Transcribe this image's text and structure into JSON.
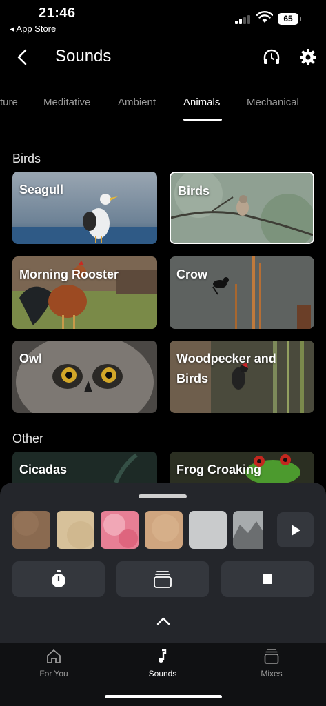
{
  "status_bar": {
    "time": "21:46",
    "back_app": "◂ App Store",
    "battery": "65"
  },
  "header": {
    "title": "Sounds",
    "back_icon": "chevron-left-icon",
    "headphones_icon": "headphones-icon",
    "settings_icon": "gear-icon"
  },
  "tabs": [
    {
      "label": "ture",
      "active": false
    },
    {
      "label": "Meditative",
      "active": false
    },
    {
      "label": "Ambient",
      "active": false
    },
    {
      "label": "Animals",
      "active": true
    },
    {
      "label": "Mechanical",
      "active": false
    }
  ],
  "sections": {
    "birds": {
      "label": "Birds",
      "cards": [
        {
          "label": "Seagull",
          "selected": false
        },
        {
          "label": "Birds",
          "selected": true
        },
        {
          "label": "Morning Rooster",
          "selected": false
        },
        {
          "label": "Crow",
          "selected": false
        },
        {
          "label": "Owl",
          "selected": false
        },
        {
          "label": "Woodpecker and Birds",
          "selected": false
        }
      ]
    },
    "other": {
      "label": "Other",
      "cards": [
        {
          "label": "Cicadas"
        },
        {
          "label": "Frog Croaking"
        }
      ]
    }
  },
  "player": {
    "swatches": [
      "#8a6a50",
      "#d7c19a",
      "#e77f95",
      "#cfa57f",
      "#c9cbcc",
      "#6b6e70"
    ],
    "play_icon": "play-icon",
    "timer_icon": "stopwatch-icon",
    "mixes_icon": "stack-icon",
    "stop_icon": "stop-icon",
    "expand_icon": "chevron-up-icon"
  },
  "tab_bar": {
    "items": [
      {
        "label": "For You",
        "icon": "home-icon",
        "active": false
      },
      {
        "label": "Sounds",
        "icon": "music-note-icon",
        "active": true
      },
      {
        "label": "Mixes",
        "icon": "stack-icon",
        "active": false
      }
    ]
  }
}
